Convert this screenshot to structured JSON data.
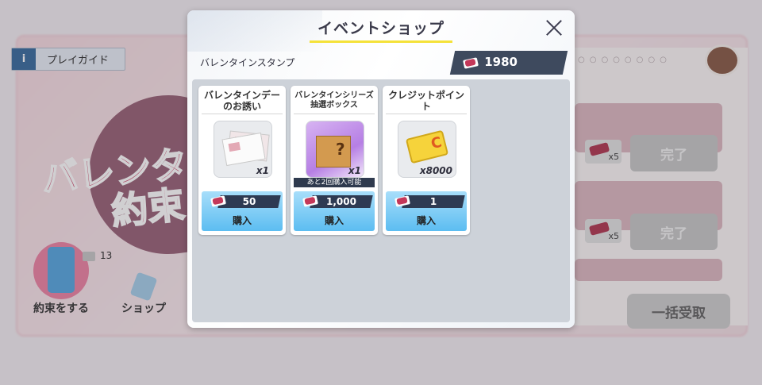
{
  "background": {
    "guide_info": "i",
    "guide_label": "プレイガイド",
    "title_line1": "バレンタ",
    "title_line2": "約束",
    "count": "13",
    "nav_promise": "約束をする",
    "nav_shop": "ショップ",
    "done_label": "完了",
    "ticket_qty": "x5",
    "collect_all": "一括受取"
  },
  "modal": {
    "title": "イベントショップ",
    "currency_label": "バレンタインスタンプ",
    "currency_value": "1980"
  },
  "items": [
    {
      "name": "バレンタインデーのお誘い",
      "qty": "x1",
      "price": "50",
      "buy_label": "購入"
    },
    {
      "name": "バレンタインシリーズ抽選ボックス",
      "qty": "x1",
      "limit": "あと2回購入可能",
      "price": "1,000",
      "buy_label": "購入"
    },
    {
      "name": "クレジットポイント",
      "qty": "x8000",
      "price": "1",
      "buy_label": "購入"
    }
  ],
  "colors": {
    "accent_yellow": "#f5e23a",
    "buy_blue": "#5cbdf1",
    "dark_navy": "#2e3a52",
    "stamp_red": "#c43859"
  },
  "icons": {
    "close": "close-icon",
    "currency": "valentine-stamp-icon"
  }
}
